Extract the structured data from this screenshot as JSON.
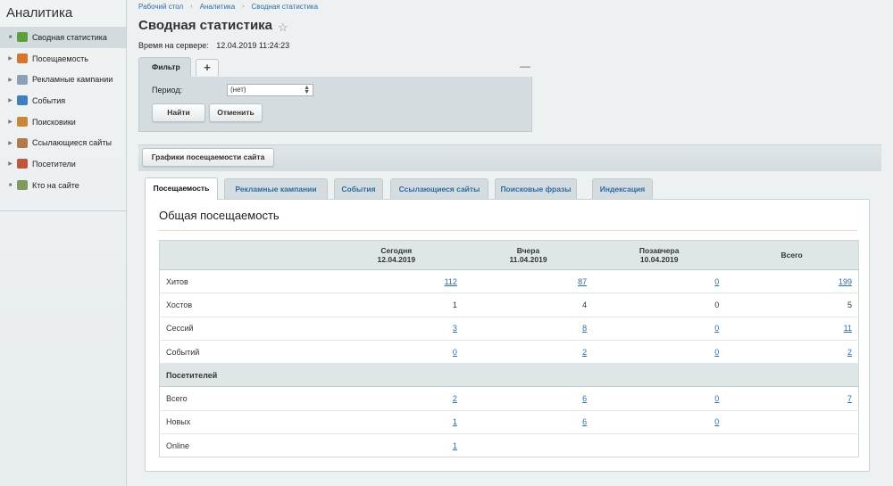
{
  "sidebar": {
    "title": "Аналитика",
    "items": [
      {
        "label": "Сводная статистика",
        "icon": "summary-icon",
        "color": "#5d9f3a",
        "active": true,
        "arrow": "■"
      },
      {
        "label": "Посещаемость",
        "icon": "bar-chart-icon",
        "color": "#d9742b",
        "arrow": "▶"
      },
      {
        "label": "Рекламные кампании",
        "icon": "campaign-icon",
        "color": "#8aa1b8",
        "arrow": "▶"
      },
      {
        "label": "События",
        "icon": "events-icon",
        "color": "#3e7fbf",
        "arrow": "▶"
      },
      {
        "label": "Поисковики",
        "icon": "search-engines-icon",
        "color": "#c9873a",
        "arrow": "▶"
      },
      {
        "label": "Ссылающиеся сайты",
        "icon": "referrers-icon",
        "color": "#b07a4a",
        "arrow": "▶"
      },
      {
        "label": "Посетители",
        "icon": "visitors-icon",
        "color": "#c0573a",
        "arrow": "▶"
      },
      {
        "label": "Кто на сайте",
        "icon": "who-online-icon",
        "color": "#7f9a5a",
        "arrow": "■"
      }
    ]
  },
  "breadcrumb": [
    "Рабочий стол",
    "Аналитика",
    "Сводная статистика"
  ],
  "breadcrumb_sep": "›",
  "page": {
    "title": "Сводная статистика",
    "star": "☆",
    "server_time_label": "Время на сервере:",
    "server_time_value": "12.04.2019 11:24:23"
  },
  "filter": {
    "tab_label": "Фильтр",
    "add_label": "+",
    "minimize_label": "—",
    "period_label": "Период:",
    "period_value": "(нет)",
    "find_label": "Найти",
    "cancel_label": "Отменить"
  },
  "charts_button": "Графики посещаемости сайта",
  "tabs": [
    {
      "label": "Посещаемость",
      "active": true
    },
    {
      "label": "Рекламные кампании"
    },
    {
      "label": "События"
    },
    {
      "label": "Ссылающиеся сайты"
    },
    {
      "label": "Поисковые фразы"
    },
    {
      "label": "Индексация"
    }
  ],
  "content": {
    "title": "Общая посещаемость",
    "columns": [
      {
        "line1": "Сегодня",
        "line2": "12.04.2019"
      },
      {
        "line1": "Вчера",
        "line2": "11.04.2019"
      },
      {
        "line1": "Позавчера",
        "line2": "10.04.2019"
      },
      {
        "line1": "Всего",
        "line2": ""
      }
    ],
    "rows": [
      {
        "label": "Хитов",
        "values": [
          "112",
          "87",
          "0",
          "199"
        ],
        "links": true
      },
      {
        "label": "Хостов",
        "values": [
          "1",
          "4",
          "0",
          "5"
        ],
        "links": false
      },
      {
        "label": "Сессий",
        "values": [
          "3",
          "8",
          "0",
          "11"
        ],
        "links": true
      },
      {
        "label": "Событий",
        "values": [
          "0",
          "2",
          "0",
          "2"
        ],
        "links": true
      },
      {
        "section": "Посетителей"
      },
      {
        "label": "Всего",
        "values": [
          "2",
          "6",
          "0",
          "7"
        ],
        "links": true
      },
      {
        "label": "Новых",
        "values": [
          "1",
          "6",
          "0",
          ""
        ],
        "links": true
      },
      {
        "label": "Online",
        "values": [
          "1",
          "",
          "",
          ""
        ],
        "links": true
      }
    ]
  },
  "colors": {
    "link": "#2b6ca5",
    "panel": "#d4dcdf",
    "sidebar_active": "#d2dbde"
  }
}
